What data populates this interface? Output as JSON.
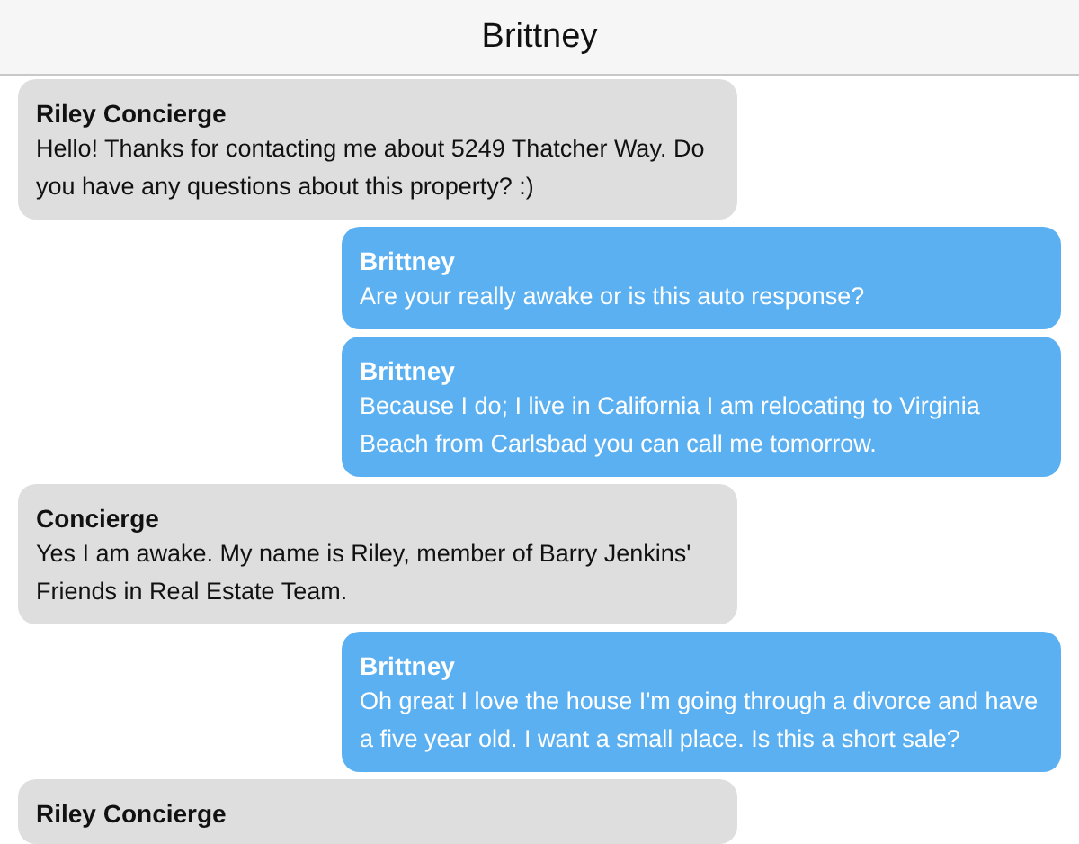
{
  "window": {
    "title": "Brittney"
  },
  "messages": [
    {
      "kind": "incoming",
      "sender": "Riley Concierge",
      "text": "Hello! Thanks for contacting me about 5249 Thatcher Way. Do you have any questions about this property? :)"
    },
    {
      "kind": "outgoing",
      "sender": "Brittney",
      "text": "Are your really awake or is this auto response?"
    },
    {
      "kind": "outgoing",
      "sender": "Brittney",
      "text": "Because I do; I live in California I am relocating to Virginia Beach from Carlsbad you can call me tomorrow."
    },
    {
      "kind": "incoming",
      "sender": "Concierge",
      "text": "Yes I am awake. My name is Riley, member of Barry Jenkins' Friends in Real Estate Team."
    },
    {
      "kind": "outgoing",
      "sender": "Brittney",
      "text": "Oh great I love the house I'm going through a divorce and have a five year old. I want a small place. Is this a short sale?"
    },
    {
      "kind": "incoming",
      "sender": "Riley Concierge"
    }
  ]
}
